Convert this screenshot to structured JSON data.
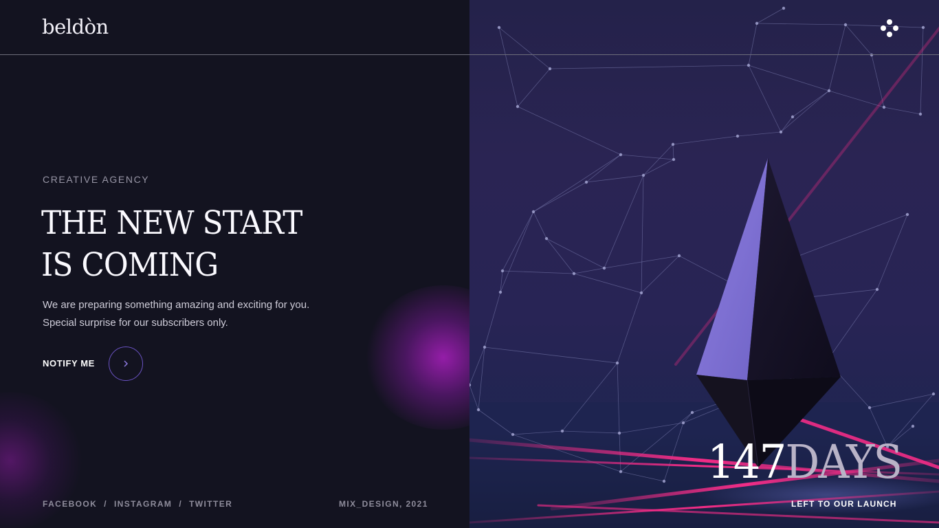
{
  "brand": {
    "logo_text": "beldòn"
  },
  "header": {
    "menu_icon": "dots-menu-icon"
  },
  "hero": {
    "eyebrow": "CREATIVE AGENCY",
    "headline_line1": "THE NEW START",
    "headline_line2": "IS COMING",
    "lead_line1": "We are preparing something amazing and exciting for you.",
    "lead_line2": "Special surprise for our subscribers only.",
    "cta_label": "NOTIFY ME",
    "cta_icon": "chevron-right-icon"
  },
  "footer": {
    "social": [
      "FACEBOOK",
      "INSTAGRAM",
      "TWITTER"
    ],
    "separator": "/",
    "credit": "MIX_DESIGN, 2021"
  },
  "countdown": {
    "number": "147",
    "unit": "DAYS",
    "caption": "LEFT TO OUR LAUNCH"
  },
  "colors": {
    "background": "#131320",
    "accent_purple": "#6b53c4",
    "glow_magenta": "#9b1eaf",
    "laser_pink": "#e0257a"
  }
}
